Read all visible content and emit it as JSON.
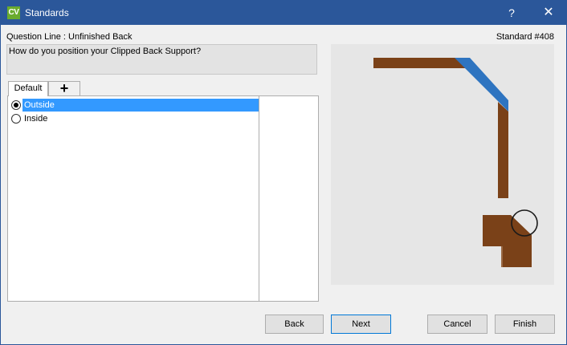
{
  "window": {
    "app_icon_text": "CV",
    "title": "Standards",
    "help_glyph": "?",
    "close_glyph": "✕"
  },
  "header": {
    "question_line": "Question Line : Unfinished Back",
    "standard_number": "Standard #408",
    "question_text": "How do you position your Clipped Back Support?"
  },
  "tabs": [
    {
      "label": "Default"
    },
    {
      "label": "+"
    }
  ],
  "options": [
    {
      "label": "Outside",
      "selected": true
    },
    {
      "label": "Inside",
      "selected": false
    }
  ],
  "buttons": {
    "back": "Back",
    "next": "Next",
    "cancel": "Cancel",
    "finish": "Finish"
  },
  "colors": {
    "titlebar": "#2b579a",
    "selection": "#3399ff",
    "wood": "#7a4118",
    "clip": "#2e74c0"
  }
}
